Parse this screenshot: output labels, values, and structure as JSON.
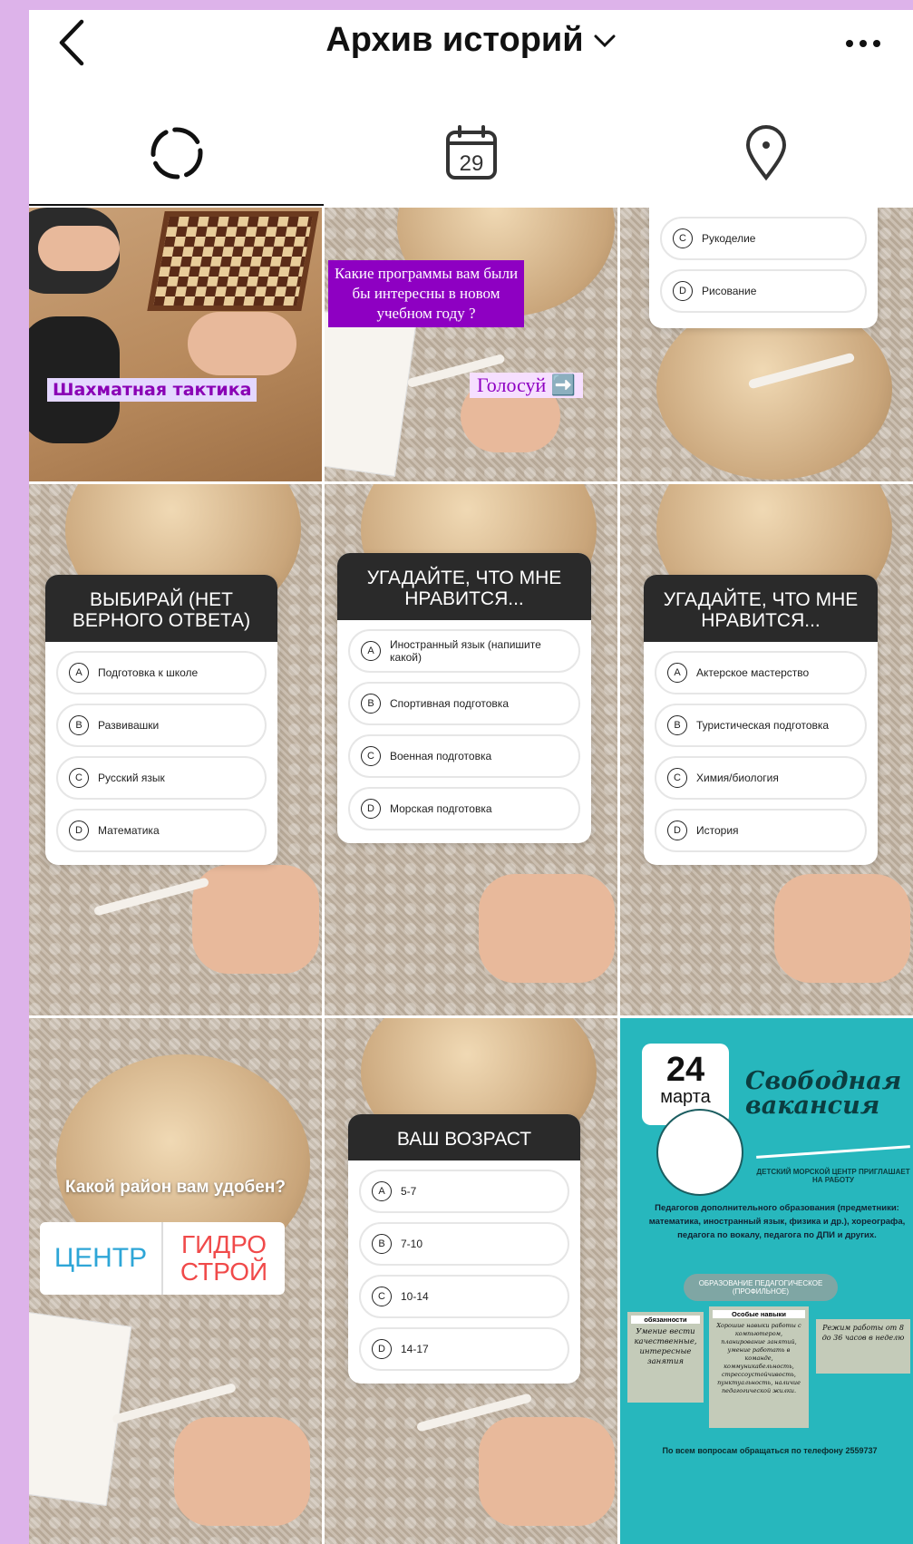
{
  "header": {
    "title": "Архив историй"
  },
  "tabs": [
    {
      "name": "stories-archive"
    },
    {
      "name": "calendar",
      "date": "29"
    },
    {
      "name": "location"
    }
  ],
  "cells": {
    "chess": {
      "caption": "Шахматная тактика"
    },
    "programs": {
      "question": "Какие программы вам были бы интересны в новом учебном году ?",
      "cta": "Голосуй ➡️"
    },
    "crafts": {
      "options": [
        {
          "letter": "C",
          "label": "Рукоделие"
        },
        {
          "letter": "D",
          "label": "Рисование"
        }
      ]
    },
    "choose": {
      "title": "ВЫБИРАЙ (НЕТ ВЕРНОГО ОТВЕТА)",
      "options": [
        {
          "letter": "A",
          "label": "Подготовка к школе"
        },
        {
          "letter": "B",
          "label": "Развивашки"
        },
        {
          "letter": "C",
          "label": "Русский язык"
        },
        {
          "letter": "D",
          "label": "Математика"
        }
      ]
    },
    "guess1": {
      "title": "УГАДАЙТЕ, ЧТО МНЕ НРАВИТСЯ...",
      "options": [
        {
          "letter": "A",
          "label": "Иностранный язык (напишите какой)"
        },
        {
          "letter": "B",
          "label": "Спортивная подготовка"
        },
        {
          "letter": "C",
          "label": "Военная подготовка"
        },
        {
          "letter": "D",
          "label": "Морская подготовка"
        }
      ]
    },
    "guess2": {
      "title": "УГАДАЙТЕ, ЧТО МНЕ НРАВИТСЯ...",
      "options": [
        {
          "letter": "A",
          "label": "Актерское мастерство"
        },
        {
          "letter": "B",
          "label": "Туристическая подготовка"
        },
        {
          "letter": "C",
          "label": "Химия/биология"
        },
        {
          "letter": "D",
          "label": "История"
        }
      ]
    },
    "region": {
      "question": "Какой район вам удобен?",
      "a": "ЦЕНТР",
      "b": "ГИДРО СТРОЙ"
    },
    "age": {
      "title": "ВАШ ВОЗРАСТ",
      "options": [
        {
          "letter": "A",
          "label": "5-7"
        },
        {
          "letter": "B",
          "label": "7-10"
        },
        {
          "letter": "C",
          "label": "10-14"
        },
        {
          "letter": "D",
          "label": "14-17"
        }
      ]
    },
    "vacancy": {
      "day": "24",
      "month": "марта",
      "headline": "Свободная вакансия",
      "sub": "ДЕТСКИЙ МОРСКОЙ ЦЕНТР ПРИГЛАШАЕТ НА РАБОТУ",
      "body": "Педагогов дополнительного образования (предметники: математика, иностранный язык, физика и др.), хореографа, педагога по вокалу, педагога по ДПИ и других.",
      "pill": "ОБРАЗОВАНИЕ ПЕДАГОГИЧЕСКОЕ (ПРОФИЛЬНОЕ)",
      "col1_head": "обязанности",
      "col1": "Умение вести качественные, интересные занятия",
      "col2_head": "Особые навыки",
      "col2": "Хорошие навыки работы с компьютером, планирование занятий, умение работать в команде, коммуникабельность, стрессоустойчивость, пунктуальность, наличие педагогической жилки.",
      "col3": "Режим работы от 8 до 36 часов в неделю",
      "footer": "По всем вопросам обращаться по телефону 2559737"
    }
  },
  "colors": {
    "background": "#ddb3ea",
    "poll_header": "#2a2a2a",
    "accent_purple": "#8e00c2",
    "vacancy_teal": "#27b7bd"
  }
}
